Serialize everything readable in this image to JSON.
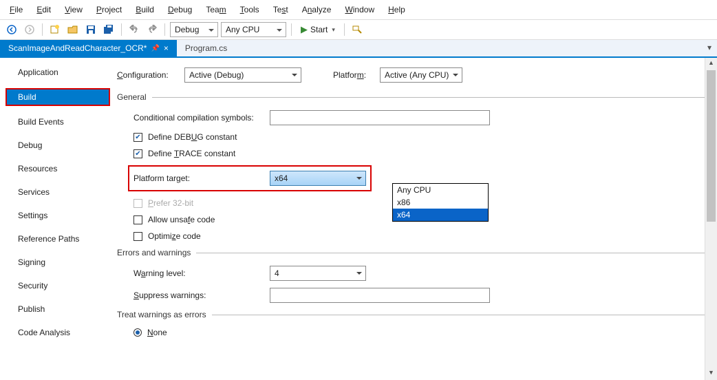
{
  "menu": [
    "File",
    "Edit",
    "View",
    "Project",
    "Build",
    "Debug",
    "Team",
    "Tools",
    "Test",
    "Analyze",
    "Window",
    "Help"
  ],
  "menu_accel": [
    "F",
    "E",
    "V",
    "P",
    "B",
    "D",
    "",
    "T",
    "",
    "",
    "W",
    "H"
  ],
  "toolbar": {
    "config": "Debug",
    "platform": "Any CPU",
    "start": "Start"
  },
  "tabs": {
    "active": "ScanImageAndReadCharacter_OCR*",
    "other": "Program.cs"
  },
  "sidebar": [
    "Application",
    "Build",
    "Build Events",
    "Debug",
    "Resources",
    "Services",
    "Settings",
    "Reference Paths",
    "Signing",
    "Security",
    "Publish",
    "Code Analysis"
  ],
  "sidebar_selected": 1,
  "cfg": {
    "config_label": "Configuration:",
    "config_value": "Active (Debug)",
    "platform_label": "Platform:",
    "platform_value": "Active (Any CPU)"
  },
  "groups": {
    "general": "General",
    "errors": "Errors and warnings",
    "treat": "Treat warnings as errors"
  },
  "fields": {
    "cond_sym": "Conditional compilation symbols:",
    "def_debug": "Define DEBUG constant",
    "def_trace": "Define TRACE constant",
    "platform_target": "Platform target:",
    "platform_target_value": "x64",
    "prefer32": "Prefer 32-bit",
    "unsafe": "Allow unsafe code",
    "optimize": "Optimize code",
    "warn_level": "Warning level:",
    "warn_level_value": "4",
    "suppress": "Suppress warnings:",
    "none": "None"
  },
  "platform_options": [
    "Any CPU",
    "x86",
    "x64"
  ],
  "platform_selected_index": 2
}
